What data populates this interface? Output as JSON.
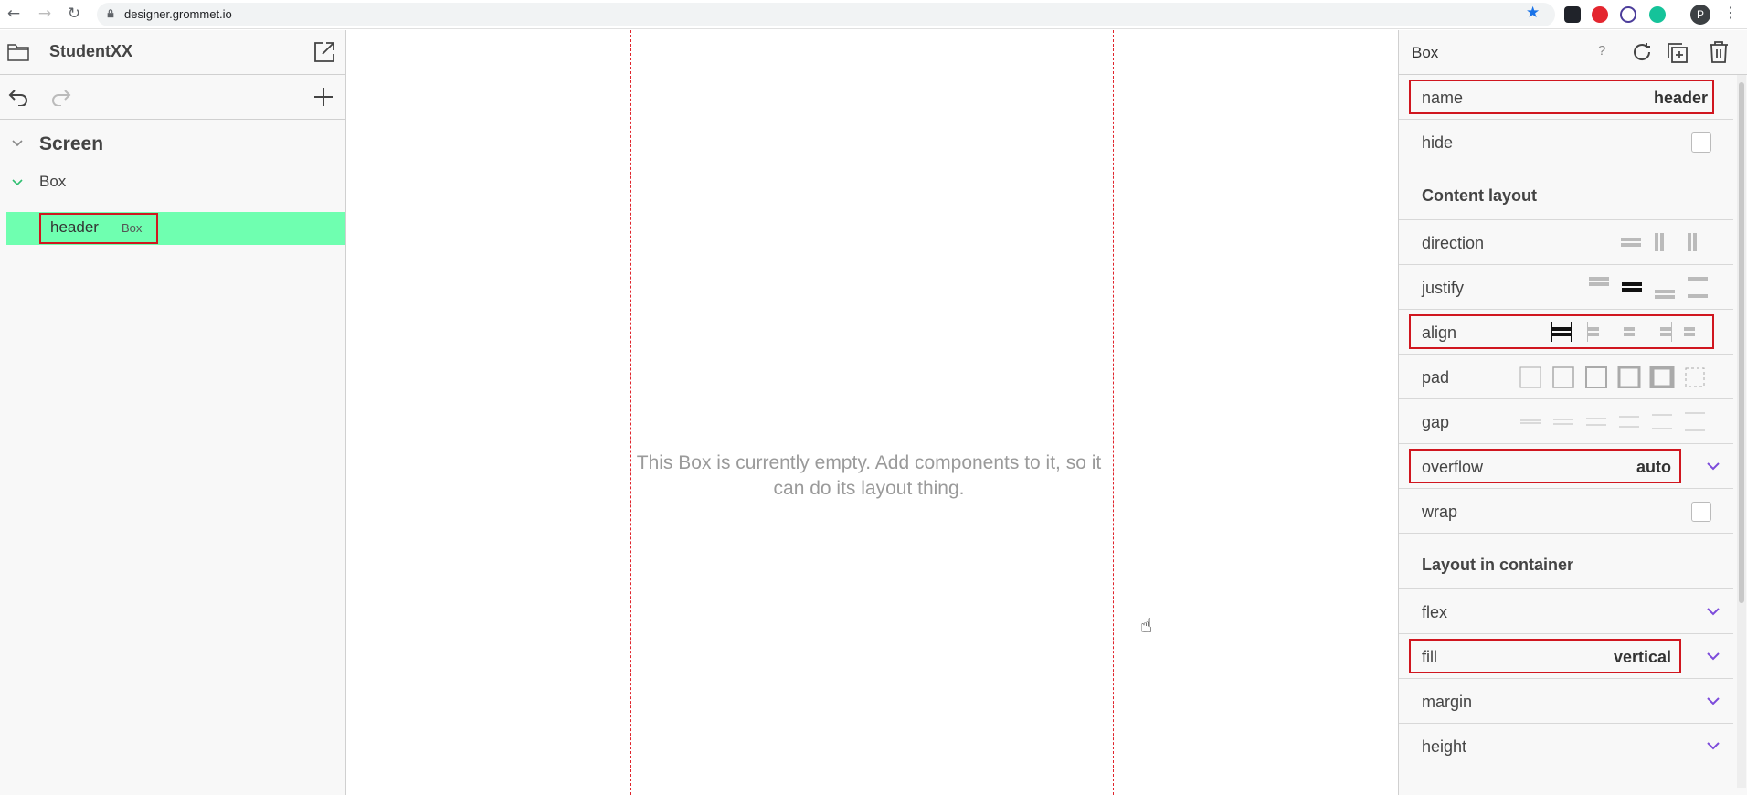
{
  "browser": {
    "url": "designer.grommet.io",
    "profile_initial": "P"
  },
  "left_panel": {
    "project_name": "StudentXX",
    "tree": {
      "screen_label": "Screen",
      "box_label": "Box",
      "header_label": "header",
      "header_type": "Box"
    }
  },
  "canvas": {
    "empty_message": "This Box is currently empty. Add components to it, so it can do its layout thing."
  },
  "properties": {
    "title": "Box",
    "help": "?",
    "name_label": "name",
    "name_value": "header",
    "hide_label": "hide",
    "content_layout": "Content layout",
    "direction_label": "direction",
    "justify_label": "justify",
    "align_label": "align",
    "pad_label": "pad",
    "gap_label": "gap",
    "overflow_label": "overflow",
    "overflow_value": "auto",
    "wrap_label": "wrap",
    "layout_in_container": "Layout in container",
    "flex_label": "flex",
    "fill_label": "fill",
    "fill_value": "vertical",
    "margin_label": "margin",
    "height_label": "height"
  },
  "colors": {
    "selected_row": "#6fffb0",
    "highlight_border": "#d0161f",
    "chevron": "#7d4cdb",
    "canvas_guide": "#e0242c"
  }
}
